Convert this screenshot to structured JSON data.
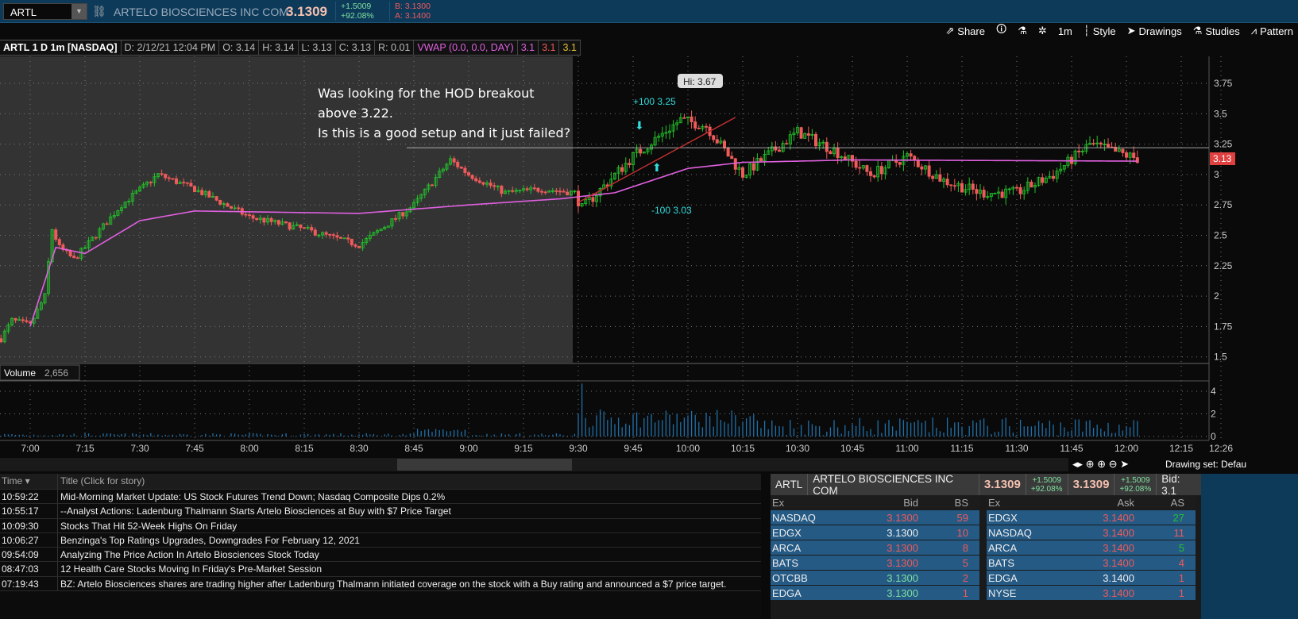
{
  "topbar": {
    "symbol": "ARTL",
    "company": "ARTELO BIOSCIENCES INC COM",
    "last": "3.1309",
    "change": "+1.5009",
    "change_pct": "+92.08%",
    "bid": "B: 3.1300",
    "ask": "A: 3.1400"
  },
  "toolbar": {
    "share": "Share",
    "timeframe": "1m",
    "style": "Style",
    "drawings": "Drawings",
    "studies": "Studies",
    "patterns": "Pattern"
  },
  "chart_header": {
    "title": "ARTL 1 D 1m [NASDAQ]",
    "date": "D: 2/12/21 12:04 PM",
    "open": "O: 3.14",
    "high": "H: 3.14",
    "low": "L: 3.13",
    "close": "C: 3.13",
    "range": "R: 0.01",
    "vwap": "VWAP (0.0, 0.0, DAY)",
    "v1": "3.1",
    "v2": "3.1",
    "v3": "3.1"
  },
  "annotation": {
    "line1": "Was looking for the HOD breakout",
    "line2": "above 3.22.",
    "line3": "Is this is a good setup and it just failed?"
  },
  "hi_bubble": "Hi: 3.67",
  "buy_label": "+100 3.25",
  "sell_label": "-100 3.03",
  "current_price": "3.13",
  "colors": {
    "up": "#22c32a",
    "down": "#f05a5a",
    "vwap": "#e060e0",
    "trend": "#c03030",
    "hline": "#ffffff"
  },
  "chart_data": {
    "type": "candlestick",
    "price_axis": {
      "min": 1.5,
      "max": 3.75,
      "ticks": [
        "3.75",
        "3.5",
        "3.25",
        "3",
        "2.75",
        "2.5",
        "2.25",
        "2",
        "1.75",
        "1.5"
      ]
    },
    "time_ticks": [
      "7:00",
      "7:15",
      "7:30",
      "7:45",
      "8:00",
      "8:15",
      "8:30",
      "8:45",
      "9:00",
      "9:15",
      "9:30",
      "9:45",
      "10:00",
      "10:15",
      "10:30",
      "10:45",
      "11:00",
      "11:15",
      "11:30",
      "11:45",
      "12:00",
      "12:15",
      "12:26"
    ],
    "price_path": [
      [
        -8,
        1.65
      ],
      [
        -5,
        1.8
      ],
      [
        0,
        1.76
      ],
      [
        4,
        2.0
      ],
      [
        6,
        2.55
      ],
      [
        8,
        2.4
      ],
      [
        12,
        2.3
      ],
      [
        15,
        2.4
      ],
      [
        25,
        2.75
      ],
      [
        35,
        3.0
      ],
      [
        45,
        2.88
      ],
      [
        60,
        2.65
      ],
      [
        75,
        2.55
      ],
      [
        90,
        2.42
      ],
      [
        105,
        2.75
      ],
      [
        115,
        3.12
      ],
      [
        120,
        3.0
      ],
      [
        130,
        2.85
      ],
      [
        140,
        2.88
      ],
      [
        149,
        2.85
      ],
      [
        151,
        2.72
      ],
      [
        165,
        3.15
      ],
      [
        178,
        3.45
      ],
      [
        185,
        3.4
      ],
      [
        195,
        3.0
      ],
      [
        210,
        3.35
      ],
      [
        220,
        3.2
      ],
      [
        230,
        3.0
      ],
      [
        240,
        3.15
      ],
      [
        250,
        2.95
      ],
      [
        260,
        2.85
      ],
      [
        270,
        2.85
      ],
      [
        280,
        3.0
      ],
      [
        290,
        3.25
      ],
      [
        303,
        3.13
      ]
    ],
    "vwap_path": [
      [
        0,
        1.75
      ],
      [
        7,
        2.4
      ],
      [
        15,
        2.35
      ],
      [
        30,
        2.62
      ],
      [
        45,
        2.7
      ],
      [
        90,
        2.68
      ],
      [
        120,
        2.75
      ],
      [
        145,
        2.8
      ],
      [
        160,
        2.85
      ],
      [
        180,
        3.05
      ],
      [
        195,
        3.1
      ],
      [
        225,
        3.12
      ],
      [
        303,
        3.11
      ]
    ],
    "hline": 3.22,
    "trendline": [
      [
        150,
        2.77
      ],
      [
        193,
        3.47
      ]
    ],
    "volume_label": "Volume",
    "volume_value": "2,656",
    "volume_ticks": [
      "4",
      "2",
      "0"
    ]
  },
  "scroll_footer": {
    "drawing_set": "Drawing set: Defau"
  },
  "news": {
    "col_time": "Time",
    "col_title": "Title (Click for story)",
    "rows": [
      {
        "time": "10:59:22",
        "title": "Mid-Morning Market Update: US Stock Futures Trend Down; Nasdaq Composite Dips 0.2%"
      },
      {
        "time": "10:55:17",
        "title": "--Analyst Actions: Ladenburg Thalmann Starts Artelo Biosciences at Buy with $7 Price Target"
      },
      {
        "time": "10:09:30",
        "title": "Stocks That Hit 52-Week Highs On Friday"
      },
      {
        "time": "10:06:27",
        "title": "Benzinga's Top Ratings Upgrades, Downgrades For February 12, 2021"
      },
      {
        "time": "09:54:09",
        "title": "Analyzing The Price Action In Artelo Biosciences Stock Today"
      },
      {
        "time": "08:47:03",
        "title": "12 Health Care Stocks Moving In Friday's Pre-Market Session"
      },
      {
        "time": "07:19:43",
        "title": "BZ: Artelo Biosciences shares are trading higher after Ladenburg Thalmann initiated coverage on the stock with a Buy rating and announced a $7 price target."
      }
    ]
  },
  "level2": {
    "symbol": "ARTL",
    "company": "ARTELO BIOSCIENCES INC COM",
    "last": "3.1309",
    "change": "+1.5009",
    "change_pct": "+92.08%",
    "last2": "3.1309",
    "change2": "+1.5009",
    "change_pct2": "+92.08%",
    "bid_label": "Bid: 3.1",
    "bid_headers": [
      "Ex",
      "Bid",
      "BS"
    ],
    "ask_headers": [
      "Ex",
      "Ask",
      "AS"
    ],
    "bids": [
      {
        "ex": "NASDAQ",
        "px": "3.1300",
        "sz": "59",
        "c": "#f05a5a",
        "sc": "#f05a5a"
      },
      {
        "ex": "EDGX",
        "px": "3.1300",
        "sz": "10",
        "c": "#eeeeee",
        "sc": "#f05a5a"
      },
      {
        "ex": "ARCA",
        "px": "3.1300",
        "sz": "8",
        "c": "#f05a5a",
        "sc": "#f05a5a"
      },
      {
        "ex": "BATS",
        "px": "3.1300",
        "sz": "5",
        "c": "#f05a5a",
        "sc": "#f05a5a"
      },
      {
        "ex": "OTCBB",
        "px": "3.1300",
        "sz": "2",
        "c": "#7fe0a0",
        "sc": "#f05a5a"
      },
      {
        "ex": "EDGA",
        "px": "3.1300",
        "sz": "1",
        "c": "#7fe0a0",
        "sc": "#f05a5a"
      }
    ],
    "asks": [
      {
        "ex": "EDGX",
        "px": "3.1400",
        "sz": "27",
        "c": "#f05a5a",
        "sc": "#22c32a"
      },
      {
        "ex": "NASDAQ",
        "px": "3.1400",
        "sz": "11",
        "c": "#f05a5a",
        "sc": "#f05a5a"
      },
      {
        "ex": "ARCA",
        "px": "3.1400",
        "sz": "5",
        "c": "#f05a5a",
        "sc": "#22c32a"
      },
      {
        "ex": "BATS",
        "px": "3.1400",
        "sz": "4",
        "c": "#f05a5a",
        "sc": "#f05a5a"
      },
      {
        "ex": "EDGA",
        "px": "3.1400",
        "sz": "1",
        "c": "#eeeeee",
        "sc": "#f05a5a"
      },
      {
        "ex": "NYSE",
        "px": "3.1400",
        "sz": "1",
        "c": "#f05a5a",
        "sc": "#f05a5a"
      }
    ]
  }
}
